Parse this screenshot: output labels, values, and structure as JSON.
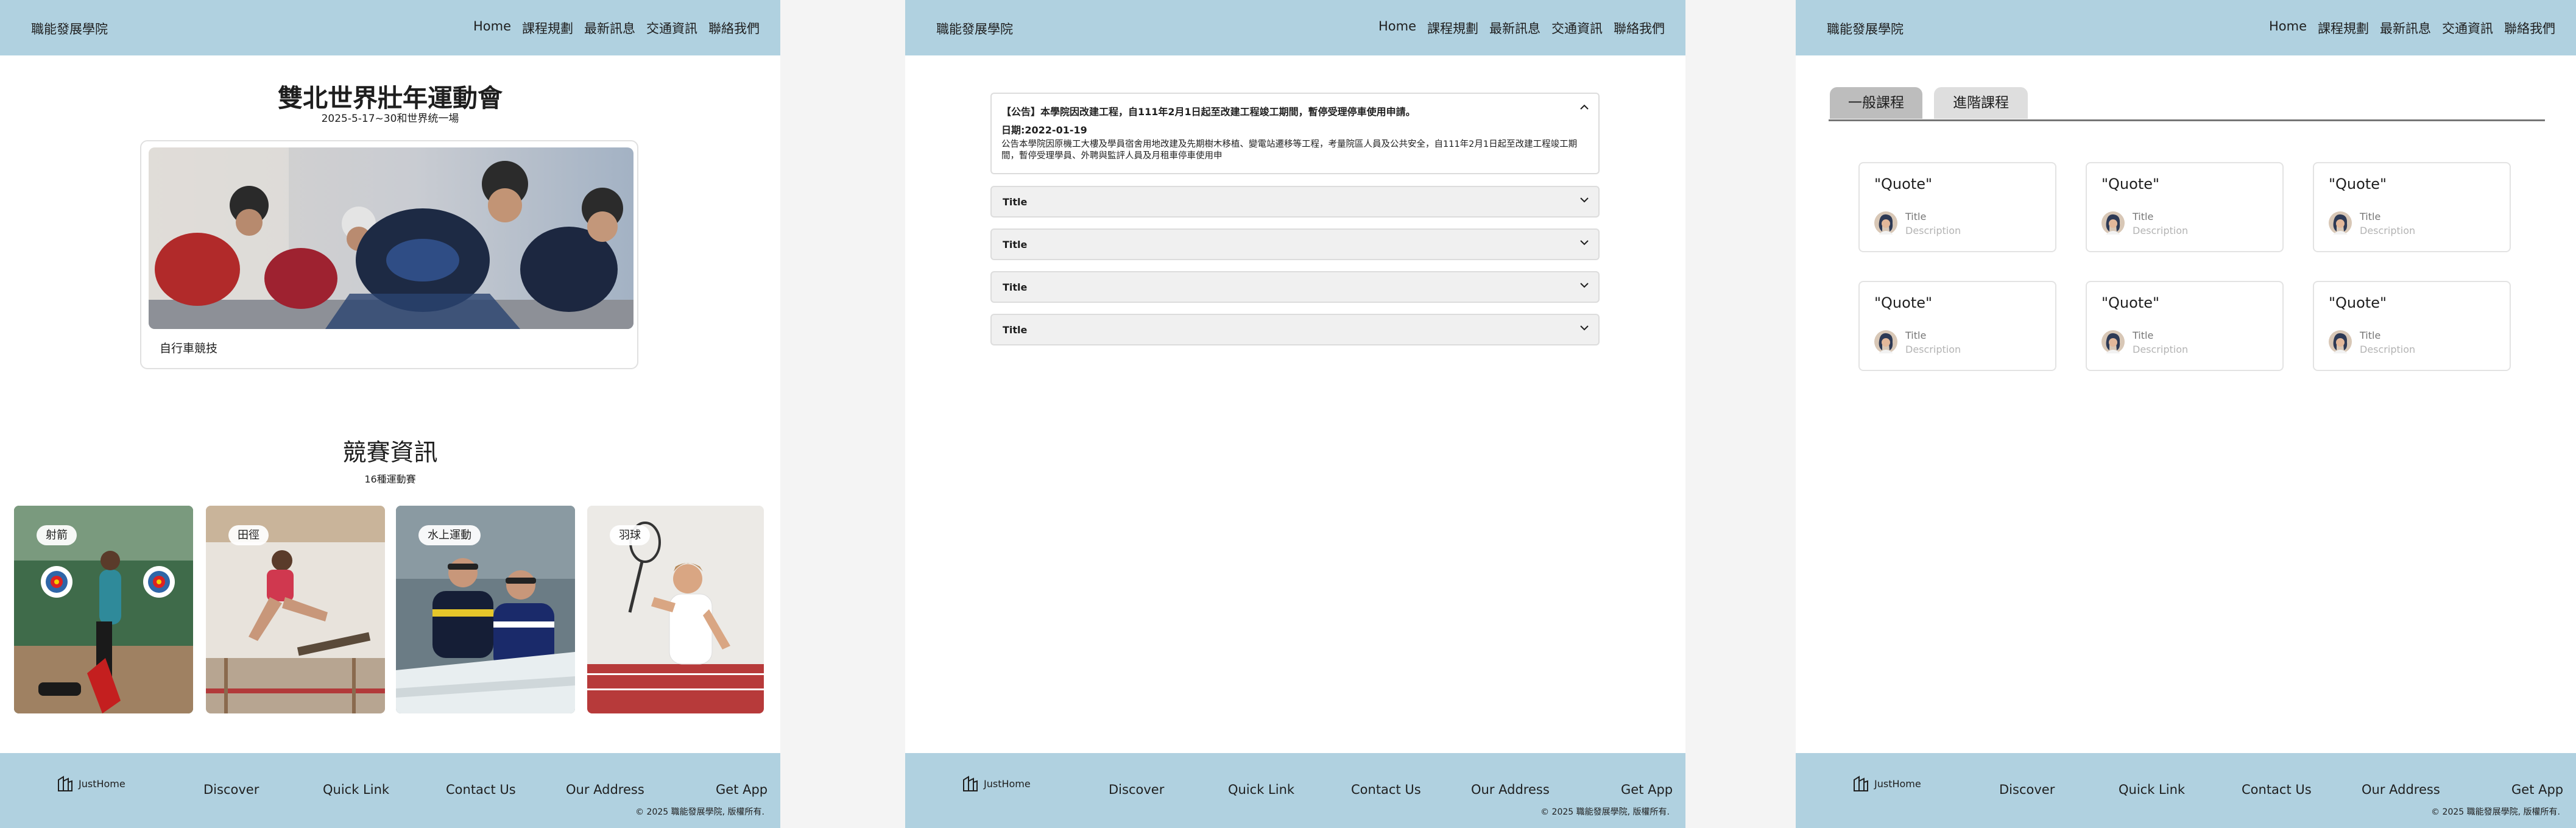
{
  "site": {
    "brand": "職能發展學院",
    "nav": [
      "Home",
      "課程規劃",
      "最新訊息",
      "交通資訊",
      "聯絡我們"
    ]
  },
  "footer": {
    "logo_text": "JustHome",
    "links": [
      "Discover",
      "Quick Link",
      "Contact Us",
      "Our Address",
      "Get App"
    ],
    "copyright": "© 2025 職能發展學院, 版權所有."
  },
  "home": {
    "event_title": "雙北世界壯年運動會",
    "event_subtitle": "2025-5-17~30和世界统一場",
    "hero_caption": "自行車競技",
    "section_title": "競賽資訊",
    "section_subtitle": "16種運動賽",
    "sports": [
      "射箭",
      "田徑",
      "水上運動",
      "羽球"
    ]
  },
  "news": {
    "open_item": {
      "title": "【公告】本學院因改建工程，自111年2月1日起至改建工程竣工期間，暫停受理停車使用申請。",
      "date": "日期:2022-01-19",
      "body": "公告本學院因原機工大樓及學員宿舍用地改建及先期樹木移植、變電站遷移等工程，考量院區人員及公共安全，自111年2月1日起至改建工程竣工期間，暫停受理學員、外聘與監評人員及月租車停車使用申"
    },
    "items": [
      "Title",
      "Title",
      "Title",
      "Title"
    ]
  },
  "courses": {
    "tabs": [
      "一般課程",
      "進階課程"
    ],
    "cards": [
      {
        "quote": "\"Quote\"",
        "title": "Title",
        "description": "Description"
      },
      {
        "quote": "\"Quote\"",
        "title": "Title",
        "description": "Description"
      },
      {
        "quote": "\"Quote\"",
        "title": "Title",
        "description": "Description"
      },
      {
        "quote": "\"Quote\"",
        "title": "Title",
        "description": "Description"
      },
      {
        "quote": "\"Quote\"",
        "title": "Title",
        "description": "Description"
      },
      {
        "quote": "\"Quote\"",
        "title": "Title",
        "description": "Description"
      }
    ]
  },
  "colors": {
    "header_bg": "#b0d1e0",
    "footer_bg": "#b0d1e0",
    "tab_active": "#bdbdbd",
    "tab_inactive": "#dedede"
  },
  "icons": {
    "logo": "building-logo-icon",
    "expand": "chevron-down-icon",
    "collapse": "chevron-up-icon",
    "avatar": "avatar-icon"
  }
}
